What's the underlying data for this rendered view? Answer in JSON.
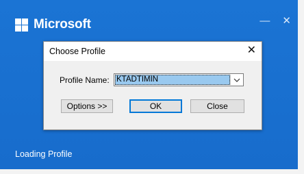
{
  "splash": {
    "brand": "Microsoft",
    "minimize_glyph": "—",
    "close_glyph": "✕",
    "status": "Loading Profile"
  },
  "dialog": {
    "title": "Choose Profile",
    "close_glyph": "✕",
    "profile_label": "Profile Name:",
    "profile_value": "KTADTIMIN",
    "options_label": "Options >>",
    "ok_label": "OK",
    "close_label": "Close"
  },
  "colors": {
    "splash_blue": "#1a73d2",
    "dialog_bg": "#f0f0f0",
    "selection": "#99c9ef",
    "default_button_border": "#0078d7"
  }
}
